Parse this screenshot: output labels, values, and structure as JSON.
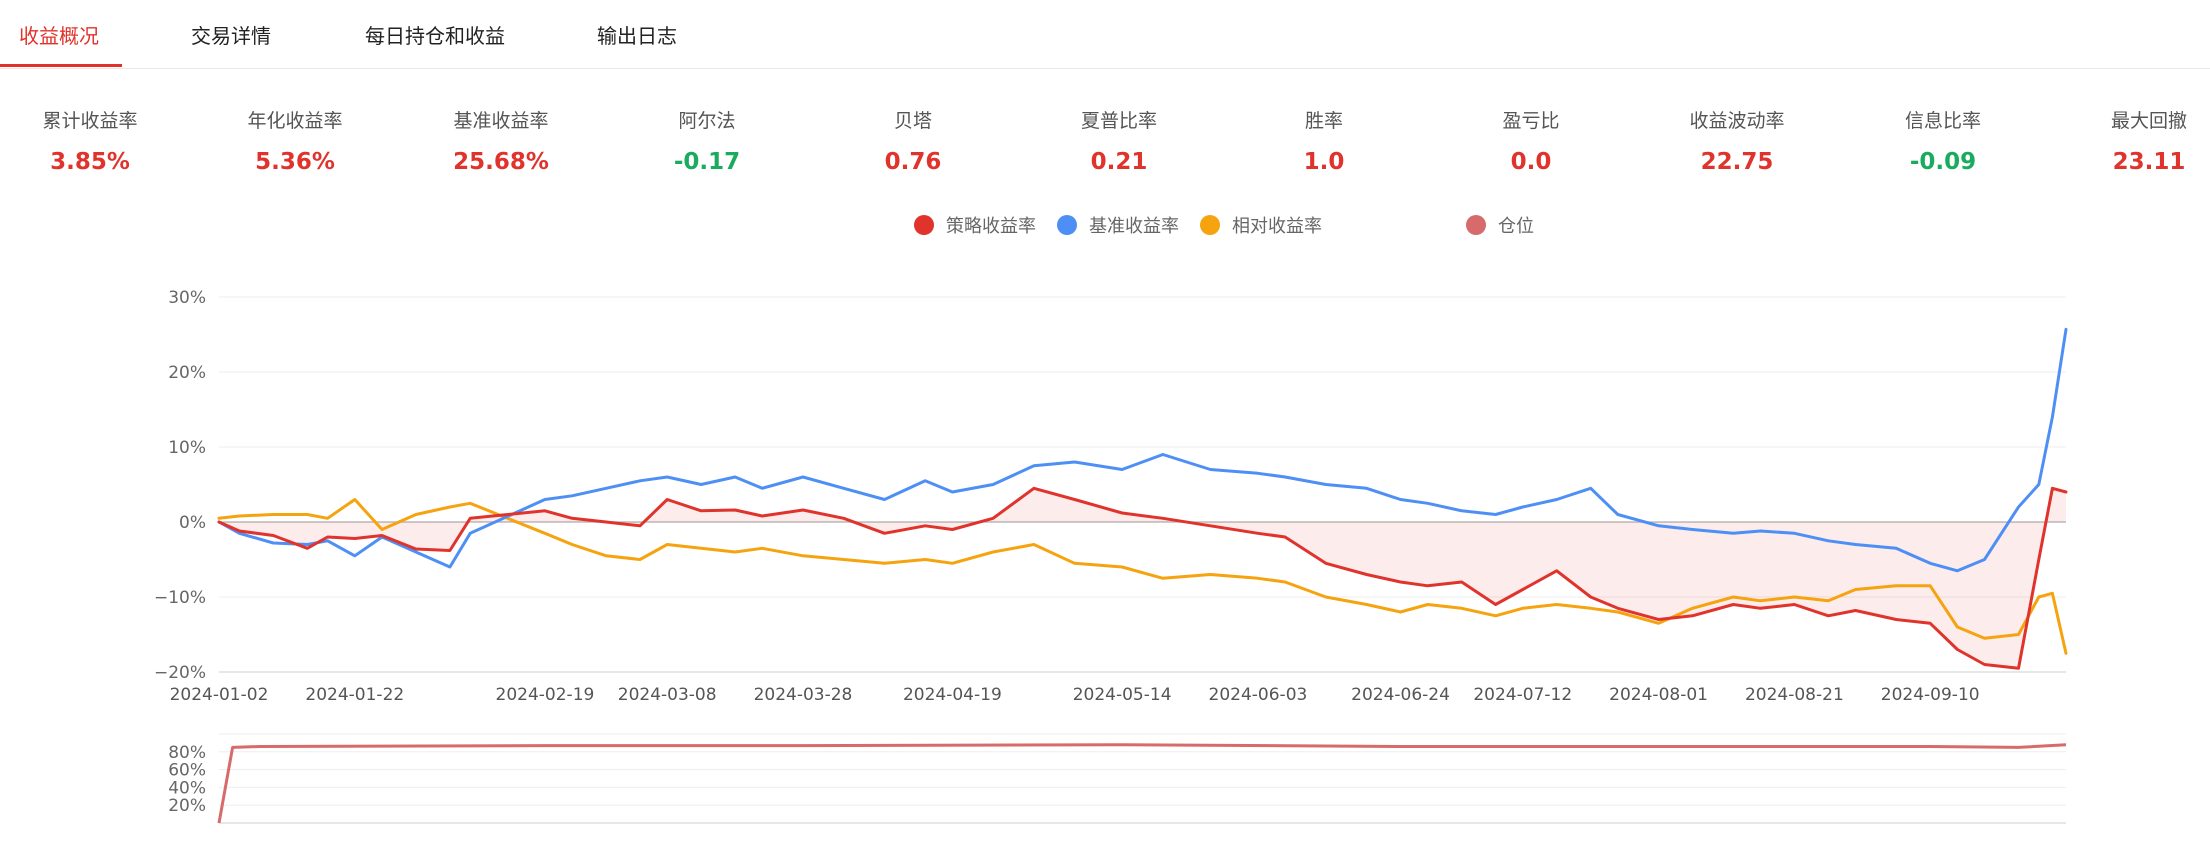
{
  "tabs": [
    {
      "label": "收益概况",
      "active": true
    },
    {
      "label": "交易详情",
      "active": false
    },
    {
      "label": "每日持仓和收益",
      "active": false
    },
    {
      "label": "输出日志",
      "active": false
    }
  ],
  "metrics": [
    {
      "label": "累计收益率",
      "value": "3.85%",
      "color": "#e0332c"
    },
    {
      "label": "年化收益率",
      "value": "5.36%",
      "color": "#e0332c"
    },
    {
      "label": "基准收益率",
      "value": "25.68%",
      "color": "#e0332c"
    },
    {
      "label": "阿尔法",
      "value": "-0.17",
      "color": "#1aab5e"
    },
    {
      "label": "贝塔",
      "value": "0.76",
      "color": "#e0332c"
    },
    {
      "label": "夏普比率",
      "value": "0.21",
      "color": "#e0332c"
    },
    {
      "label": "胜率",
      "value": "1.0",
      "color": "#e0332c"
    },
    {
      "label": "盈亏比",
      "value": "0.0",
      "color": "#e0332c"
    },
    {
      "label": "收益波动率",
      "value": "22.75",
      "color": "#e0332c"
    },
    {
      "label": "信息比率",
      "value": "-0.09",
      "color": "#1aab5e"
    },
    {
      "label": "最大回撤",
      "value": "23.11",
      "color": "#e0332c"
    }
  ],
  "legend": [
    {
      "label": "策略收益率",
      "color": "#e0332c"
    },
    {
      "label": "基准收益率",
      "color": "#4e8ff5"
    },
    {
      "label": "相对收益率",
      "color": "#f5a30f"
    },
    {
      "label": "仓位",
      "color": "#d76a6a"
    }
  ],
  "chart_data": [
    {
      "type": "line",
      "x_ticks": [
        "2024-01-02",
        "2024-01-22",
        "2024-02-19",
        "2024-03-08",
        "2024-03-28",
        "2024-04-19",
        "2024-05-14",
        "2024-06-03",
        "2024-06-24",
        "2024-07-12",
        "2024-08-01",
        "2024-08-21",
        "2024-09-10"
      ],
      "x_range": [
        "2024-01-02",
        "2024-09-30"
      ],
      "ylim": [
        -20,
        30
      ],
      "y_ticks": [
        30,
        20,
        10,
        0,
        -10,
        -20
      ],
      "y_tick_labels": [
        "30%",
        "20%",
        "10%",
        "0%",
        "−10%",
        "−20%"
      ],
      "grid": true,
      "series": [
        {
          "name": "策略收益率",
          "color": "#e0332c",
          "x": [
            "2024-01-02",
            "2024-01-05",
            "2024-01-10",
            "2024-01-15",
            "2024-01-18",
            "2024-01-22",
            "2024-01-26",
            "2024-01-31",
            "2024-02-05",
            "2024-02-08",
            "2024-02-19",
            "2024-02-23",
            "2024-02-28",
            "2024-03-04",
            "2024-03-08",
            "2024-03-13",
            "2024-03-18",
            "2024-03-22",
            "2024-03-28",
            "2024-04-03",
            "2024-04-09",
            "2024-04-15",
            "2024-04-19",
            "2024-04-25",
            "2024-05-01",
            "2024-05-07",
            "2024-05-14",
            "2024-05-20",
            "2024-05-27",
            "2024-06-03",
            "2024-06-07",
            "2024-06-13",
            "2024-06-19",
            "2024-06-24",
            "2024-06-28",
            "2024-07-03",
            "2024-07-08",
            "2024-07-12",
            "2024-07-17",
            "2024-07-22",
            "2024-07-26",
            "2024-08-01",
            "2024-08-06",
            "2024-08-12",
            "2024-08-16",
            "2024-08-21",
            "2024-08-26",
            "2024-08-30",
            "2024-09-05",
            "2024-09-10",
            "2024-09-14",
            "2024-09-18",
            "2024-09-23",
            "2024-09-26",
            "2024-09-28",
            "2024-09-30"
          ],
          "y": [
            0,
            -1.2,
            -1.8,
            -3.5,
            -2.0,
            -2.2,
            -1.8,
            -3.6,
            -3.8,
            0.5,
            1.5,
            0.5,
            0,
            -0.5,
            3.0,
            1.5,
            1.6,
            0.8,
            1.6,
            0.5,
            -1.5,
            -0.5,
            -1.0,
            0.5,
            4.5,
            3.0,
            1.2,
            0.5,
            -0.5,
            -1.5,
            -2.0,
            -5.5,
            -7.0,
            -8.0,
            -8.5,
            -8.0,
            -11.0,
            -9.0,
            -6.5,
            -10.0,
            -11.5,
            -13.0,
            -12.5,
            -11.0,
            -11.5,
            -11.0,
            -12.5,
            -11.8,
            -13.0,
            -13.5,
            -17.0,
            -19.0,
            -19.5,
            -5.0,
            4.5,
            4.0
          ]
        },
        {
          "name": "基准收益率",
          "color": "#4e8ff5",
          "x": [
            "2024-01-02",
            "2024-01-05",
            "2024-01-10",
            "2024-01-15",
            "2024-01-18",
            "2024-01-22",
            "2024-01-26",
            "2024-01-31",
            "2024-02-05",
            "2024-02-08",
            "2024-02-19",
            "2024-02-23",
            "2024-02-28",
            "2024-03-04",
            "2024-03-08",
            "2024-03-13",
            "2024-03-18",
            "2024-03-22",
            "2024-03-28",
            "2024-04-03",
            "2024-04-09",
            "2024-04-15",
            "2024-04-19",
            "2024-04-25",
            "2024-05-01",
            "2024-05-07",
            "2024-05-14",
            "2024-05-20",
            "2024-05-27",
            "2024-06-03",
            "2024-06-07",
            "2024-06-13",
            "2024-06-19",
            "2024-06-24",
            "2024-06-28",
            "2024-07-03",
            "2024-07-08",
            "2024-07-12",
            "2024-07-17",
            "2024-07-22",
            "2024-07-26",
            "2024-08-01",
            "2024-08-06",
            "2024-08-12",
            "2024-08-16",
            "2024-08-21",
            "2024-08-26",
            "2024-08-30",
            "2024-09-05",
            "2024-09-10",
            "2024-09-14",
            "2024-09-18",
            "2024-09-23",
            "2024-09-26",
            "2024-09-28",
            "2024-09-30"
          ],
          "y": [
            0,
            -1.5,
            -2.8,
            -3.0,
            -2.5,
            -4.5,
            -2.0,
            -4.0,
            -6.0,
            -1.5,
            3.0,
            3.5,
            4.5,
            5.5,
            6.0,
            5.0,
            6.0,
            4.5,
            6.0,
            4.5,
            3.0,
            5.5,
            4.0,
            5.0,
            7.5,
            8.0,
            7.0,
            9.0,
            7.0,
            6.5,
            6.0,
            5.0,
            4.5,
            3.0,
            2.5,
            1.5,
            1.0,
            2.0,
            3.0,
            4.5,
            1.0,
            -0.5,
            -1.0,
            -1.5,
            -1.2,
            -1.5,
            -2.5,
            -3.0,
            -3.5,
            -5.5,
            -6.5,
            -5.0,
            2.0,
            5.0,
            14.0,
            25.7
          ]
        },
        {
          "name": "相对收益率",
          "color": "#f5a30f",
          "x": [
            "2024-01-02",
            "2024-01-05",
            "2024-01-10",
            "2024-01-15",
            "2024-01-18",
            "2024-01-22",
            "2024-01-26",
            "2024-01-31",
            "2024-02-05",
            "2024-02-08",
            "2024-02-19",
            "2024-02-23",
            "2024-02-28",
            "2024-03-04",
            "2024-03-08",
            "2024-03-13",
            "2024-03-18",
            "2024-03-22",
            "2024-03-28",
            "2024-04-03",
            "2024-04-09",
            "2024-04-15",
            "2024-04-19",
            "2024-04-25",
            "2024-05-01",
            "2024-05-07",
            "2024-05-14",
            "2024-05-20",
            "2024-05-27",
            "2024-06-03",
            "2024-06-07",
            "2024-06-13",
            "2024-06-19",
            "2024-06-24",
            "2024-06-28",
            "2024-07-03",
            "2024-07-08",
            "2024-07-12",
            "2024-07-17",
            "2024-07-22",
            "2024-07-26",
            "2024-08-01",
            "2024-08-06",
            "2024-08-12",
            "2024-08-16",
            "2024-08-21",
            "2024-08-26",
            "2024-08-30",
            "2024-09-05",
            "2024-09-10",
            "2024-09-14",
            "2024-09-18",
            "2024-09-23",
            "2024-09-26",
            "2024-09-28",
            "2024-09-30"
          ],
          "y": [
            0.5,
            0.8,
            1.0,
            1.0,
            0.5,
            3.0,
            -1.0,
            1.0,
            2.0,
            2.5,
            -1.5,
            -3.0,
            -4.5,
            -5.0,
            -3.0,
            -3.5,
            -4.0,
            -3.5,
            -4.5,
            -5.0,
            -5.5,
            -5.0,
            -5.5,
            -4.0,
            -3.0,
            -5.5,
            -6.0,
            -7.5,
            -7.0,
            -7.5,
            -8.0,
            -10.0,
            -11.0,
            -12.0,
            -11.0,
            -11.5,
            -12.5,
            -11.5,
            -11.0,
            -11.5,
            -12.0,
            -13.5,
            -11.5,
            -10.0,
            -10.5,
            -10.0,
            -10.5,
            -9.0,
            -8.5,
            -8.5,
            -14.0,
            -15.5,
            -15.0,
            -10.0,
            -9.5,
            -17.5
          ]
        }
      ]
    },
    {
      "type": "area",
      "name": "仓位",
      "x_range": [
        "2024-01-02",
        "2024-09-30"
      ],
      "ylim": [
        0,
        100
      ],
      "y_ticks": [
        80,
        60,
        40,
        20
      ],
      "y_tick_labels": [
        "80%",
        "60%",
        "40%",
        "20%"
      ],
      "series": [
        {
          "name": "仓位",
          "color": "#d76a6a",
          "x": [
            "2024-01-02",
            "2024-01-04",
            "2024-01-08",
            "2024-02-19",
            "2024-03-28",
            "2024-05-14",
            "2024-06-24",
            "2024-08-01",
            "2024-09-10",
            "2024-09-23",
            "2024-09-30"
          ],
          "y": [
            0,
            85,
            86,
            87,
            87,
            88,
            86,
            86,
            86,
            85,
            88
          ]
        }
      ]
    }
  ]
}
